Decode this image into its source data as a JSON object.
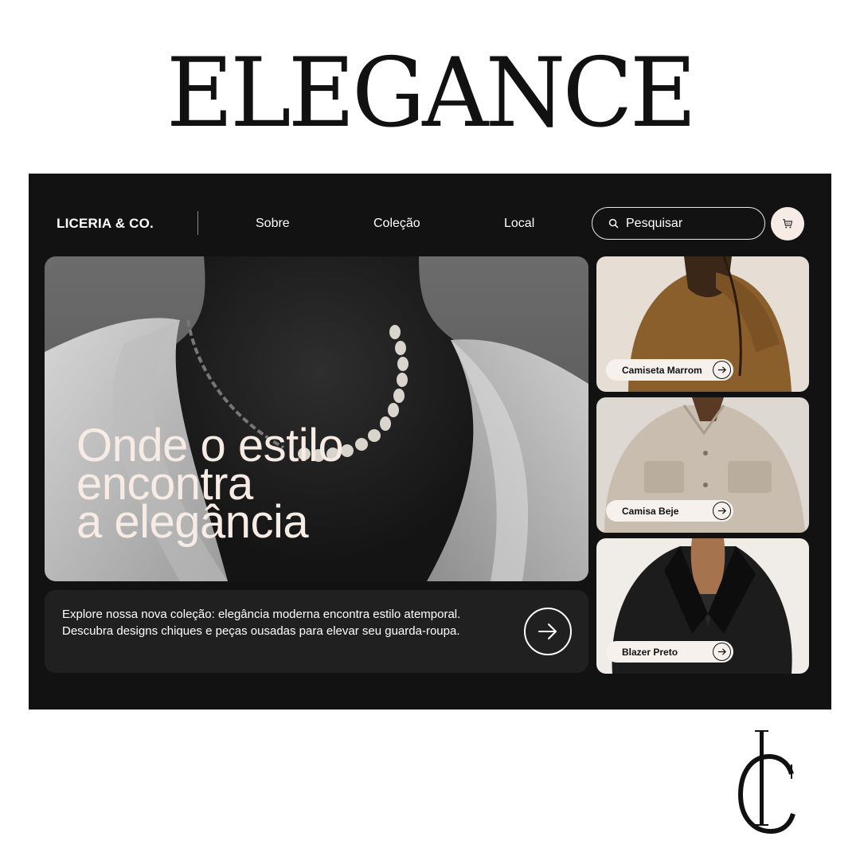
{
  "headline": "ELEGANCE",
  "nav": {
    "brand": "LICERIA & CO.",
    "links": [
      "Sobre",
      "Coleção",
      "Local"
    ],
    "search_placeholder": "Pesquisar",
    "search_icon": "search-icon",
    "cart_icon": "cart-icon"
  },
  "hero": {
    "title_lines": [
      "Onde o estilo",
      "encontra",
      "a elegância"
    ]
  },
  "description": {
    "text": "Explore nossa nova coleção: elegância moderna encontra estilo atemporal. Descubra designs chiques e peças ousadas para elevar seu guarda-roupa.",
    "arrow_icon": "arrow-right-icon"
  },
  "products": [
    {
      "label": "Camiseta Marrom"
    },
    {
      "label": "Camisa Beje"
    },
    {
      "label": "Blazer Preto"
    }
  ],
  "colors": {
    "frame_bg": "#121212",
    "card_bg": "#202020",
    "accent_cream": "#f7ebe6",
    "text_light": "#ffffff"
  }
}
